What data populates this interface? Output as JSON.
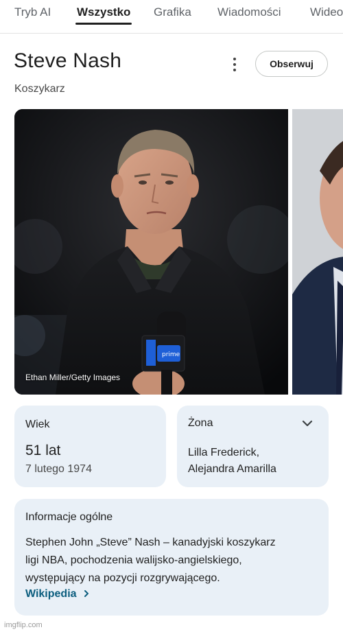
{
  "tabs": [
    {
      "label": "Tryb AI",
      "active": false
    },
    {
      "label": "Wszystko",
      "active": true
    },
    {
      "label": "Grafika",
      "active": false
    },
    {
      "label": "Wiadomości",
      "active": false
    },
    {
      "label": "Wideo",
      "active": false
    }
  ],
  "header": {
    "title": "Steve Nash",
    "subtitle": "Koszykarz",
    "follow_label": "Obserwuj",
    "menu_icon": "more-vert-icon"
  },
  "images": {
    "credit": "Ethan Miller/Getty Images"
  },
  "age_card": {
    "label": "Wiek",
    "value": "51 lat",
    "date": "7 lutego 1974"
  },
  "spouse_card": {
    "label": "Żona",
    "value_line1": "Lilla Frederick,",
    "value_line2": "Alejandra Amarilla",
    "expand_icon": "chevron-down-icon"
  },
  "info_card": {
    "title": "Informacje ogólne",
    "line1": "Stephen John „Steve” Nash – kanadyjski koszykarz",
    "line2": "ligi NBA, pochodzenia walijsko-angielskiego,",
    "line3": "występujący na pozycji rozgrywającego.",
    "source_label": "Wikipedia",
    "source_icon": "chevron-right-icon"
  },
  "watermark": "imgflip.com",
  "colors": {
    "card_bg": "#e9f0f7",
    "link": "#0b5d7e",
    "mic_logo_blue": "#1e5fd7"
  }
}
